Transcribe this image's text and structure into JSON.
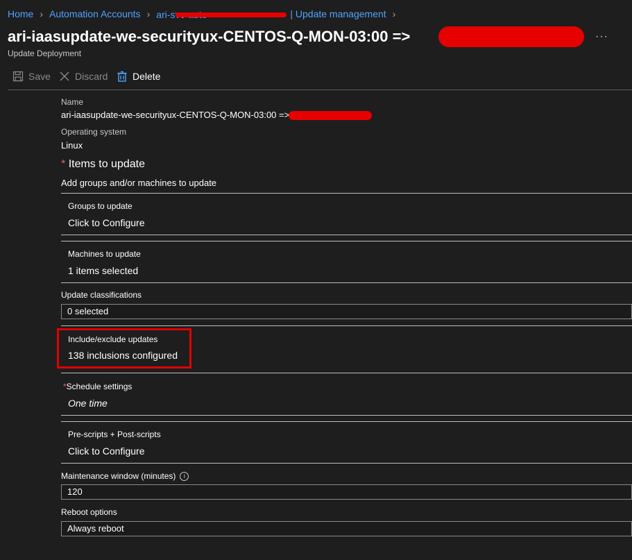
{
  "breadcrumb": {
    "items": [
      "Home",
      "Automation Accounts",
      "ari-svc-auto",
      "| Update management"
    ]
  },
  "header": {
    "title": "ari-iaasupdate-we-securityux-CENTOS-Q-MON-03:00 =>",
    "subtitle": "Update Deployment",
    "more": "···"
  },
  "toolbar": {
    "save_label": "Save",
    "discard_label": "Discard",
    "delete_label": "Delete"
  },
  "form": {
    "name_label": "Name",
    "name_value": "ari-iaasupdate-we-securityux-CENTOS-Q-MON-03:00 =>",
    "os_label": "Operating system",
    "os_value": "Linux",
    "required_marker": "*",
    "items_heading": "Items to update",
    "items_desc": "Add groups and/or machines to update",
    "groups_title": "Groups to update",
    "groups_value": "Click to Configure",
    "machines_title": "Machines to update",
    "machines_value": "1 items selected",
    "classifications_label": "Update classifications",
    "classifications_value": "0 selected",
    "include_title": "Include/exclude updates",
    "include_value": "138 inclusions configured",
    "schedule_title": "Schedule settings",
    "schedule_value": "One time",
    "scripts_title": "Pre-scripts + Post-scripts",
    "scripts_value": "Click to Configure",
    "maintenance_label": "Maintenance window (minutes)",
    "maintenance_info": "i",
    "maintenance_value": "120",
    "reboot_label": "Reboot options",
    "reboot_value": "Always reboot"
  },
  "colors": {
    "background": "#1e1e1e",
    "link": "#4fa3ff",
    "highlight": "#e00000"
  }
}
